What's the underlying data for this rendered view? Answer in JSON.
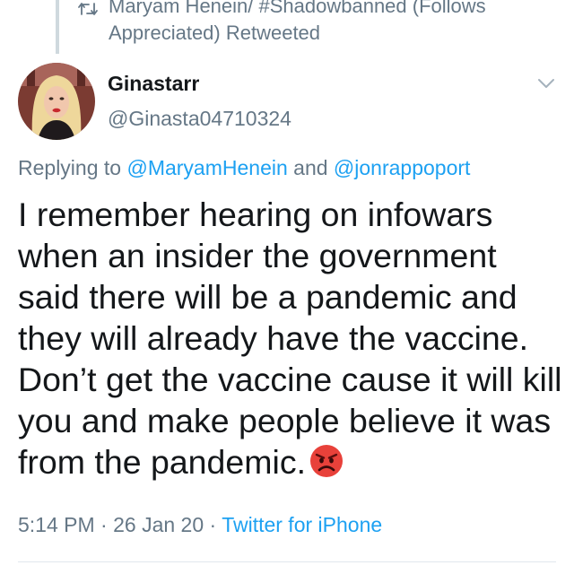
{
  "retweet": {
    "icon": "retweet-icon",
    "text": "Maryam Henein/ #Shadowbanned (Follows Appreciated) Retweeted"
  },
  "author": {
    "avatar": "avatar",
    "name": "Ginastarr",
    "handle": "@Ginasta04710324"
  },
  "menu_icon": "chevron-down-icon",
  "reply": {
    "prefix": "Replying to",
    "mention1": "@MaryamHenein",
    "conjunction": "and",
    "mention2": "@jonrappoport"
  },
  "tweet": {
    "text": "I remember hearing on infowars when an insider the government said there will be a pandemic and they will already have the vaccine. Don’t get the vaccine cause it will kill you and make people believe it was from the pandemic.",
    "emoji": "angry-face-emoji"
  },
  "meta": {
    "time": "5:14 PM",
    "sep1": "·",
    "date": "26 Jan 20",
    "sep2": "·",
    "source": "Twitter for iPhone"
  },
  "colors": {
    "link": "#1da1f2",
    "secondary_text": "#657786",
    "primary_text": "#14171a",
    "emoji": "#e8413a"
  }
}
